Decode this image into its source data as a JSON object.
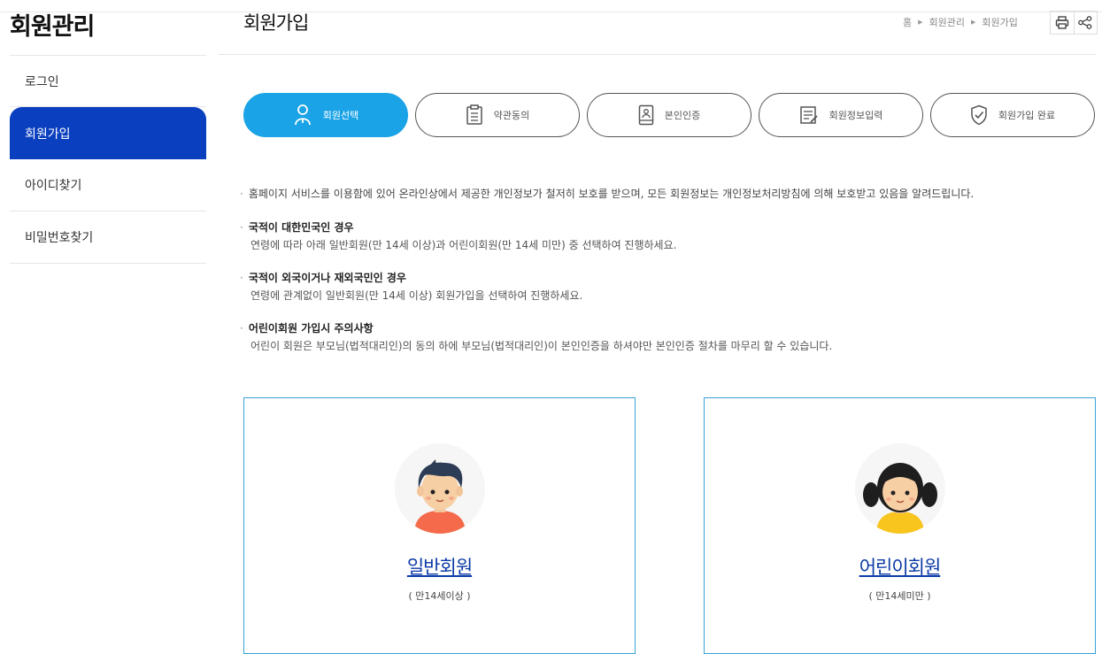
{
  "sidebar": {
    "title": "회원관리",
    "items": [
      {
        "label": "로그인",
        "active": false
      },
      {
        "label": "회원가입",
        "active": true
      },
      {
        "label": "아이디찾기",
        "active": false
      },
      {
        "label": "비밀번호찾기",
        "active": false
      }
    ]
  },
  "header": {
    "title": "회원가입",
    "breadcrumb": [
      "홈",
      "회원관리",
      "회원가입"
    ],
    "tools": {
      "print": "print-icon",
      "share": "share-icon"
    }
  },
  "steps": [
    {
      "label": "회원선택",
      "icon": "person-icon",
      "active": true
    },
    {
      "label": "약관동의",
      "icon": "clipboard-icon",
      "active": false
    },
    {
      "label": "본인인증",
      "icon": "phone-person-icon",
      "active": false
    },
    {
      "label": "회원정보입력",
      "icon": "document-edit-icon",
      "active": false
    },
    {
      "label": "회원가입 완료",
      "icon": "shield-check-icon",
      "active": false
    }
  ],
  "info": {
    "intro": "홈페이지 서비스를 이용함에 있어 온라인상에서 제공한 개인정보가 철저히 보호를 받으며, 모든 회원정보는 개인정보처리방침에 의해 보호받고 있음을 알려드립니다.",
    "notices": [
      {
        "title": "국적이 대한민국인 경우",
        "desc": "연령에 따라 아래 일반회원(만 14세 이상)과 어린이회원(만 14세 미만) 중 선택하여 진행하세요."
      },
      {
        "title": "국적이 외국이거나 재외국민인 경우",
        "desc": "연령에 관계없이 일반회원(만 14세 이상) 회원가입을 선택하여 진행하세요."
      },
      {
        "title": "어린이회원 가입시 주의사항",
        "desc": "어린이 회원은 부모님(법적대리인)의 동의 하에 부모님(법적대리인)이 본인인증을 하셔야만 본인인증 절차를 마무리 할 수 있습니다."
      }
    ]
  },
  "cards": [
    {
      "title": "일반회원",
      "sub": "( 만14세이상 )",
      "icon": "boy-avatar-icon"
    },
    {
      "title": "어린이회원",
      "sub": "( 만14세미만 )",
      "icon": "girl-avatar-icon"
    }
  ],
  "colors": {
    "sidebar_active": "#0a3fbf",
    "step_active": "#1aa3e6",
    "card_border": "#3aa2d8",
    "link": "#0b3aa6"
  }
}
